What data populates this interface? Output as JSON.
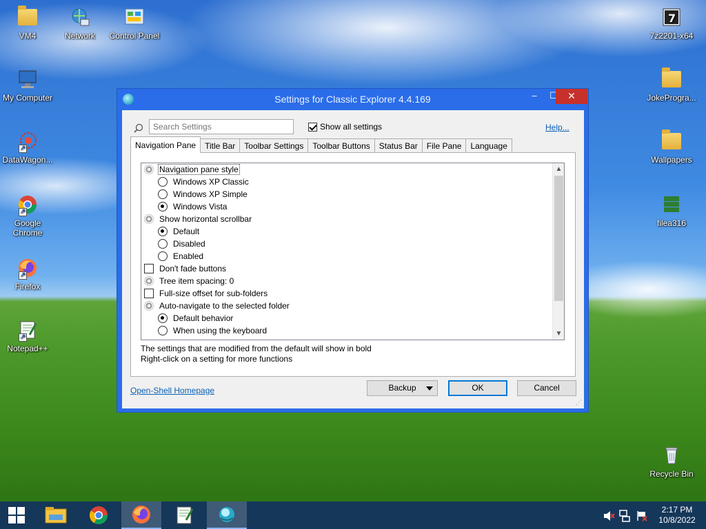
{
  "desktop": {
    "icons": [
      {
        "label": "VM4",
        "icon": "folder-icon"
      },
      {
        "label": "Network",
        "icon": "network-icon"
      },
      {
        "label": "Control Panel",
        "icon": "control-panel-icon"
      },
      {
        "label": "My Computer",
        "icon": "computer-icon"
      },
      {
        "label": "DataWagon...",
        "icon": "datawagon-icon"
      },
      {
        "label": "Google Chrome",
        "icon": "chrome-icon"
      },
      {
        "label": "Firefox",
        "icon": "firefox-icon"
      },
      {
        "label": "Notepad++",
        "icon": "notepadpp-icon"
      },
      {
        "label": "7z2201-x64",
        "icon": "7zip-installer-icon"
      },
      {
        "label": "JokeProgra...",
        "icon": "folder-icon"
      },
      {
        "label": "Wallpapers",
        "icon": "folder-icon"
      },
      {
        "label": "filea316",
        "icon": "file-icon"
      },
      {
        "label": "Recycle Bin",
        "icon": "recycle-bin-icon"
      }
    ]
  },
  "dialog": {
    "title": "Settings for Classic Explorer 4.4.169",
    "search_placeholder": "Search Settings",
    "show_all_label": "Show all settings",
    "show_all_checked": true,
    "help_label": "Help...",
    "tabs": [
      "Navigation Pane",
      "Title Bar",
      "Toolbar Settings",
      "Toolbar Buttons",
      "Status Bar",
      "File Pane",
      "Language"
    ],
    "active_tab": "Navigation Pane",
    "settings": [
      {
        "label": "Navigation pane style",
        "kind": "group",
        "level": 0
      },
      {
        "label": "Windows XP Classic",
        "kind": "radio",
        "checked": false,
        "level": 1
      },
      {
        "label": "Windows XP Simple",
        "kind": "radio",
        "checked": false,
        "level": 1
      },
      {
        "label": "Windows Vista",
        "kind": "radio",
        "checked": true,
        "level": 1
      },
      {
        "label": "Show horizontal scrollbar",
        "kind": "group",
        "level": 0
      },
      {
        "label": "Default",
        "kind": "radio",
        "checked": true,
        "level": 1
      },
      {
        "label": "Disabled",
        "kind": "radio",
        "checked": false,
        "level": 1
      },
      {
        "label": "Enabled",
        "kind": "radio",
        "checked": false,
        "level": 1
      },
      {
        "label": "Don't fade buttons",
        "kind": "checkbox",
        "checked": false,
        "level": 0
      },
      {
        "label": "Tree item spacing: 0",
        "kind": "group",
        "level": 0
      },
      {
        "label": "Full-size offset for sub-folders",
        "kind": "checkbox",
        "checked": false,
        "level": 0
      },
      {
        "label": "Auto-navigate to the selected folder",
        "kind": "group",
        "level": 0
      },
      {
        "label": "Default behavior",
        "kind": "radio",
        "checked": true,
        "level": 1
      },
      {
        "label": "When using the keyboard",
        "kind": "radio",
        "checked": false,
        "level": 1
      }
    ],
    "note_line1": "The settings that are modified from the default will show in bold",
    "note_line2": "Right-click on a setting for more functions",
    "homepage_link": "Open-Shell Homepage",
    "backup_label": "Backup",
    "ok_label": "OK",
    "cancel_label": "Cancel"
  },
  "taskbar": {
    "items": [
      "start-icon",
      "file-explorer-icon",
      "chrome-icon",
      "firefox-icon",
      "notepadpp-icon",
      "classic-explorer-settings-icon"
    ],
    "time": "2:17 PM",
    "date": "10/8/2022"
  },
  "colors": {
    "title_bar": "#2b6de8",
    "close_button": "#c7312b",
    "link": "#0b5fb4",
    "taskbar": "#14325f"
  }
}
